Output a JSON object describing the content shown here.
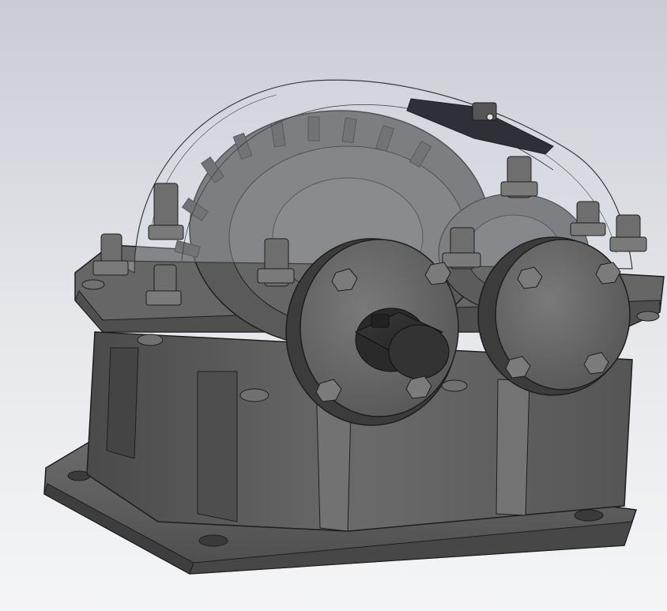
{
  "viewport": {
    "background_top": "#c9ccd4",
    "background_bottom": "#f4f5f7"
  },
  "model": {
    "housing_color": "#5f5f5f",
    "housing_dark": "#3f3f3f",
    "edge_color": "#1e1e1e",
    "cover_glass_color": "#d8dbe6",
    "gear_color": "#555555"
  }
}
